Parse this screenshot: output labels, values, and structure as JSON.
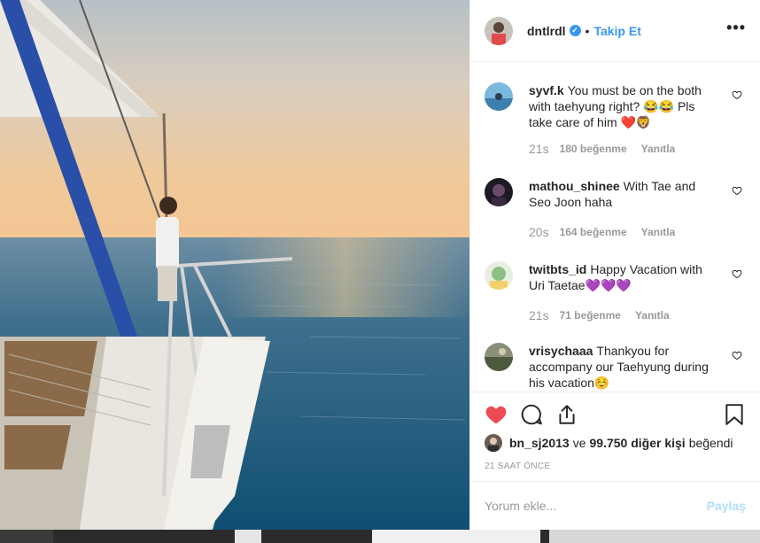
{
  "post": {
    "image_alt": "Sailboat at sunset with a person taking a photo at the bow",
    "colors": {
      "accent": "#3897f0",
      "heart": "#ed4956",
      "muted": "#999999"
    }
  },
  "header": {
    "username": "dntlrdl",
    "verified_icon": "verified-badge-icon",
    "separator": "•",
    "follow_label": "Takip Et",
    "more_label": "•••"
  },
  "comments": [
    {
      "user": "syvf.k",
      "text": "You must be on the both with taehyung right? 😂😂 Pls take care of him ❤️🦁",
      "time": "21s",
      "likes": "180 beğenme",
      "reply": "Yanıtla"
    },
    {
      "user": "mathou_shinee",
      "text": "With Tae and Seo Joon haha",
      "time": "20s",
      "likes": "164 beğenme",
      "reply": "Yanıtla"
    },
    {
      "user": "twitbts_id",
      "text": "Happy Vacation with Uri Taetae💜💜💜",
      "time": "21s",
      "likes": "71 beğenme",
      "reply": "Yanıtla"
    },
    {
      "user": "vrisychaaa",
      "text": "Thankyou for accompany our Taehyung during his vacation☺️",
      "time": "",
      "likes": "",
      "reply": ""
    }
  ],
  "actions": {
    "icons": [
      "heart-filled-icon",
      "comment-icon",
      "share-icon",
      "bookmark-icon"
    ],
    "liked_by_user": "bn_sj2013",
    "liked_by_connector": "ve",
    "liked_by_count": "99.750 diğer kişi",
    "liked_by_suffix": "beğendi",
    "timestamp": "21 SAAT ÖNCE"
  },
  "add_comment": {
    "placeholder": "Yorum ekle...",
    "share_label": "Paylaş"
  }
}
